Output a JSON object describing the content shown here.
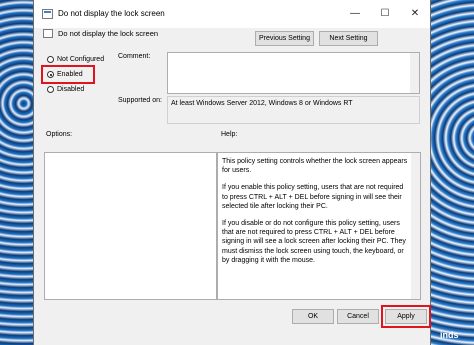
{
  "window": {
    "title": "Do not display the lock screen",
    "minimize_glyph": "—",
    "maximize_glyph": "☐",
    "close_glyph": "✕"
  },
  "header": {
    "policy_name": "Do not display the lock screen"
  },
  "nav": {
    "previous": "Previous Setting",
    "next": "Next Setting"
  },
  "state": {
    "options": [
      "Not Configured",
      "Enabled",
      "Disabled"
    ],
    "selected": "Enabled"
  },
  "comment": {
    "label": "Comment:",
    "value": ""
  },
  "supported": {
    "label": "Supported on:",
    "value": "At least Windows Server 2012, Windows 8 or Windows RT"
  },
  "options_label": "Options:",
  "help": {
    "label": "Help:",
    "paragraphs": [
      "This policy setting controls whether the lock screen appears for users.",
      "If you enable this policy setting, users that are not required to press CTRL + ALT + DEL before signing in will see their selected tile after locking their PC.",
      "If you disable or do not configure this policy setting, users that are not required to press CTRL + ALT + DEL before signing in will see a lock screen after locking their PC. They must dismiss the lock screen using touch, the keyboard, or by dragging it with the mouse."
    ]
  },
  "buttons": {
    "ok": "OK",
    "cancel": "Cancel",
    "apply": "Apply"
  },
  "icons": {
    "title": "policy-icon",
    "header": "policy-icon"
  },
  "colors": {
    "highlight": "#e0141e"
  },
  "watermark": "inds"
}
